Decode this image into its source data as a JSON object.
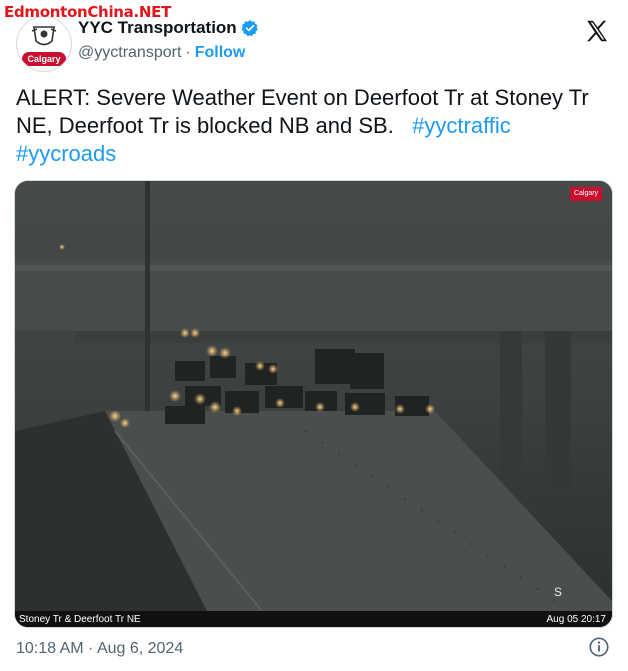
{
  "watermark": "EdmontonChina.NET",
  "author": {
    "name": "YYC Transportation",
    "handle": "@yyctransport",
    "separator": "·",
    "follow_label": "Follow",
    "avatar_label": "Calgary",
    "verified_icon": "verified-badge-icon"
  },
  "tweet": {
    "text": "ALERT: Severe Weather Event on Deerfoot Tr at Stoney Tr NE, Deerfoot Tr is blocked NB and SB.",
    "hashtags": [
      "#yyctraffic",
      "#yycroads"
    ]
  },
  "media": {
    "caption_left": "Stoney Tr & Deerfoot Tr NE",
    "caption_right": "Aug 05 20:17",
    "logo_text": "Calgary",
    "overlay_letter": "S"
  },
  "timestamp": "10:18 AM · Aug 6, 2024",
  "colors": {
    "link": "#1d9bf0",
    "verified": "#1d9bf0",
    "calgary_red": "#c8102e"
  }
}
